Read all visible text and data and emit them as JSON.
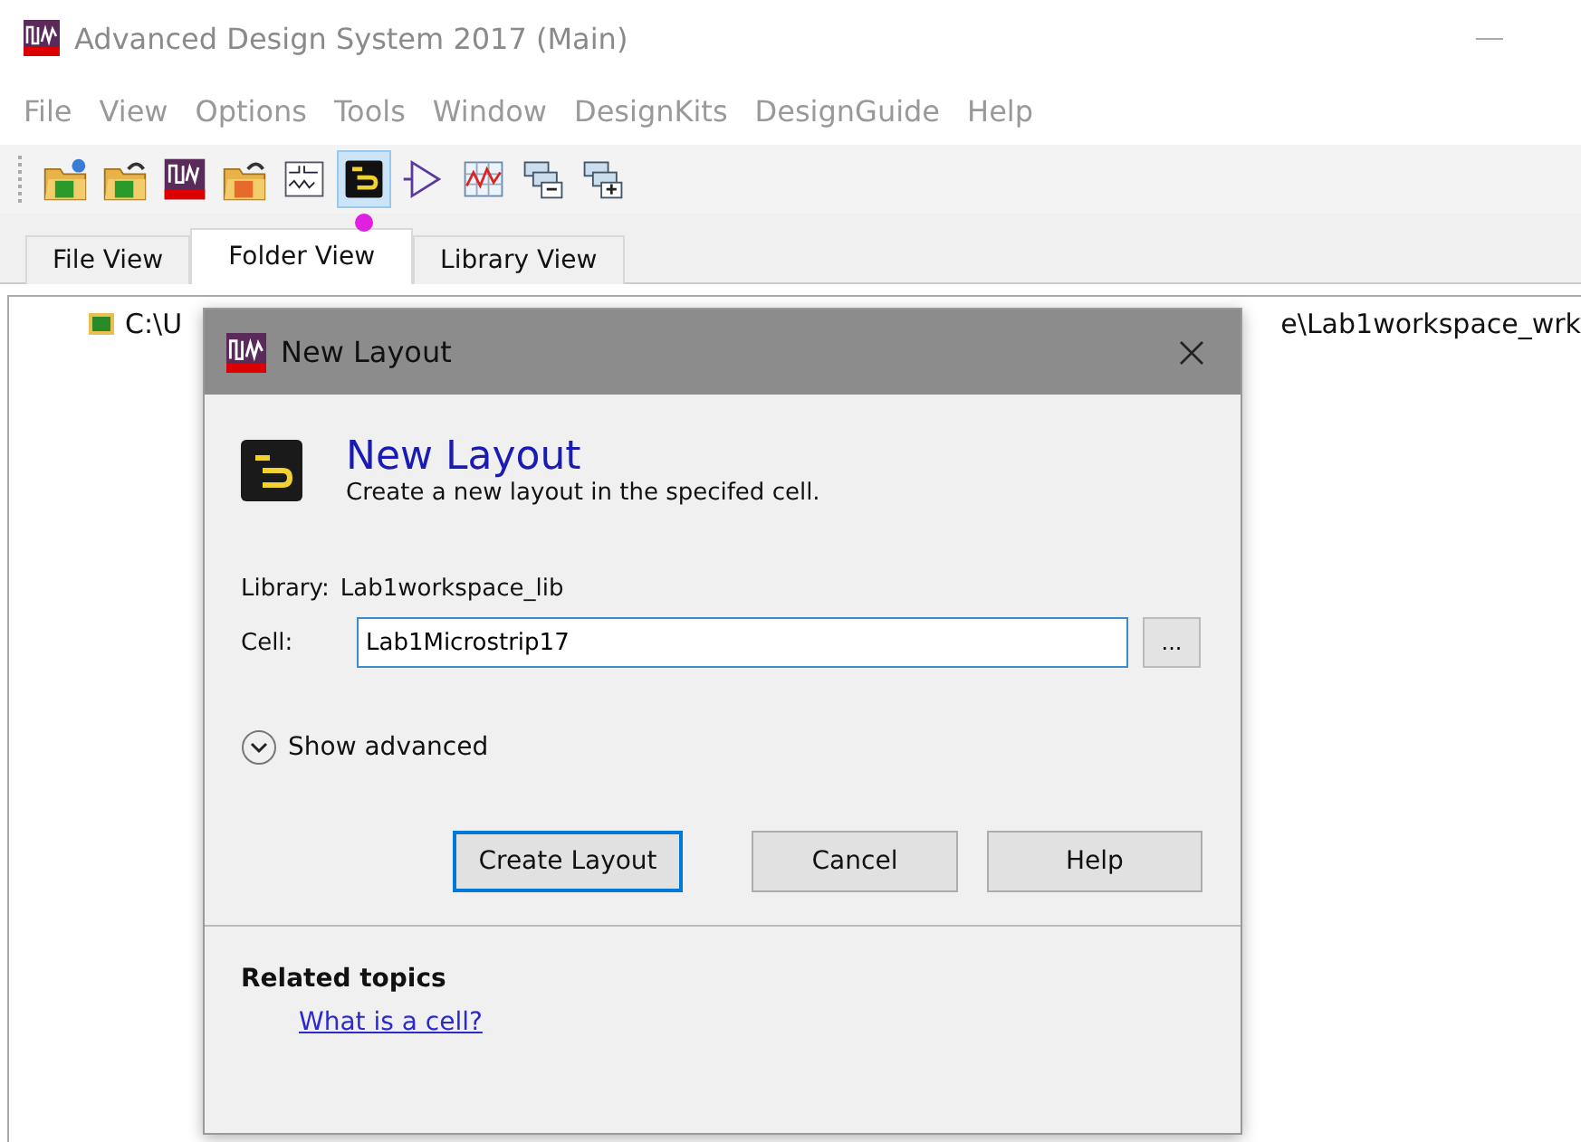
{
  "window": {
    "title": "Advanced Design System 2017 (Main)"
  },
  "menu": [
    "File",
    "View",
    "Options",
    "Tools",
    "Window",
    "DesignKits",
    "DesignGuide",
    "Help"
  ],
  "toolbar": [
    {
      "kind": "new-workspace",
      "selected": false
    },
    {
      "kind": "open-workspace",
      "selected": false
    },
    {
      "kind": "ads",
      "selected": false
    },
    {
      "kind": "open-example",
      "selected": false
    },
    {
      "kind": "schematic",
      "selected": false
    },
    {
      "kind": "layout",
      "selected": true
    },
    {
      "kind": "symbol",
      "selected": false
    },
    {
      "kind": "data-display",
      "selected": false
    },
    {
      "kind": "collapse",
      "selected": false
    },
    {
      "kind": "expand",
      "selected": false
    }
  ],
  "tabs": [
    {
      "label": "File View",
      "selected": false
    },
    {
      "label": "Folder View",
      "selected": true
    },
    {
      "label": "Library View",
      "selected": false
    }
  ],
  "tree": {
    "path_start": "C:\\U",
    "path_end": "e\\Lab1workspace_wrk"
  },
  "dialog": {
    "title": "New Layout",
    "heading": "New Layout",
    "subtitle": "Create a new layout in the specifed cell.",
    "library_label": "Library:",
    "library_value": "Lab1workspace_lib",
    "cell_label": "Cell:",
    "cell_value": "Lab1Microstrip17",
    "browse": "...",
    "show_advanced": {
      "label": "Show advanced",
      "expanded": false
    },
    "buttons": [
      {
        "label": "Create Layout",
        "default": true
      },
      {
        "label": "Cancel",
        "default": false
      },
      {
        "label": "Help",
        "default": false
      }
    ],
    "related_title": "Related topics",
    "related_link": "What is a cell?"
  }
}
